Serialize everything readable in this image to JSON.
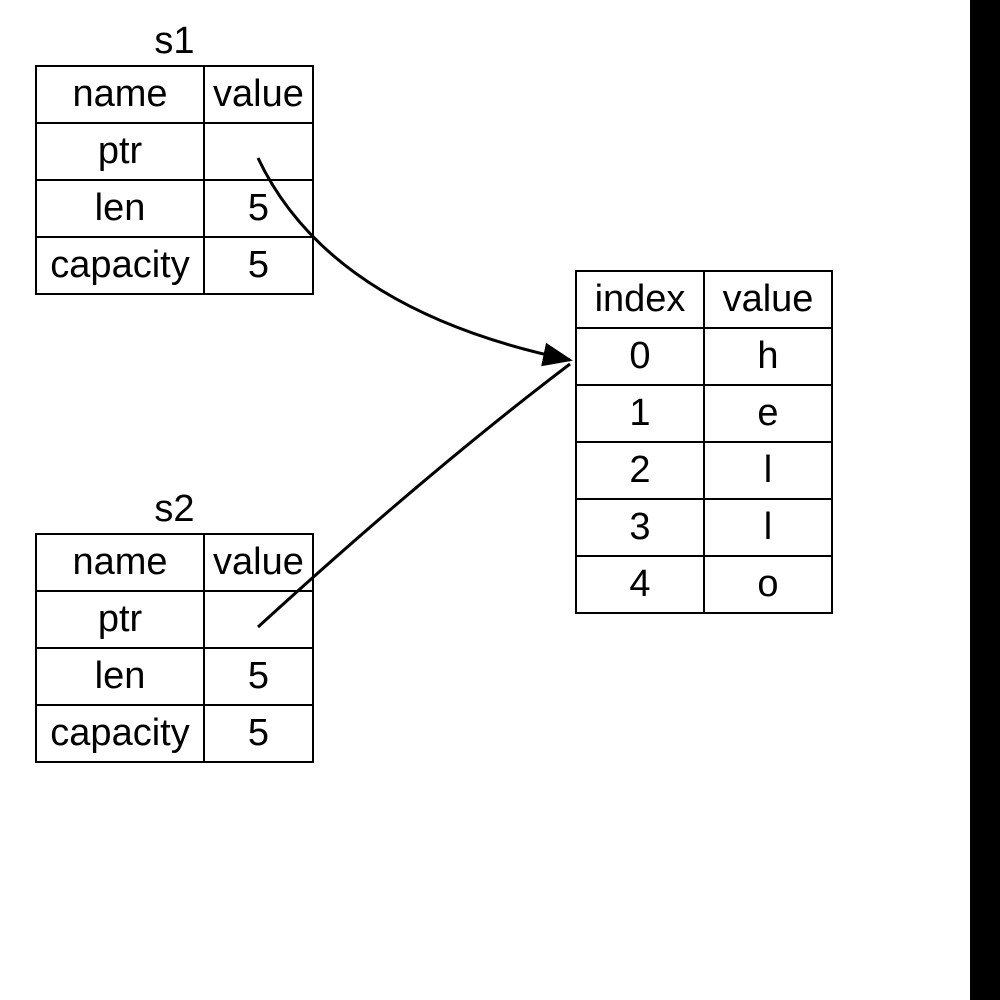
{
  "s1": {
    "title": "s1",
    "headers": {
      "name": "name",
      "value": "value"
    },
    "rows": [
      {
        "name": "ptr",
        "value": ""
      },
      {
        "name": "len",
        "value": "5"
      },
      {
        "name": "capacity",
        "value": "5"
      }
    ]
  },
  "s2": {
    "title": "s2",
    "headers": {
      "name": "name",
      "value": "value"
    },
    "rows": [
      {
        "name": "ptr",
        "value": ""
      },
      {
        "name": "len",
        "value": "5"
      },
      {
        "name": "capacity",
        "value": "5"
      }
    ]
  },
  "heap": {
    "headers": {
      "index": "index",
      "value": "value"
    },
    "rows": [
      {
        "index": "0",
        "value": "h"
      },
      {
        "index": "1",
        "value": "e"
      },
      {
        "index": "2",
        "value": "l"
      },
      {
        "index": "3",
        "value": "l"
      },
      {
        "index": "4",
        "value": "o"
      }
    ]
  }
}
